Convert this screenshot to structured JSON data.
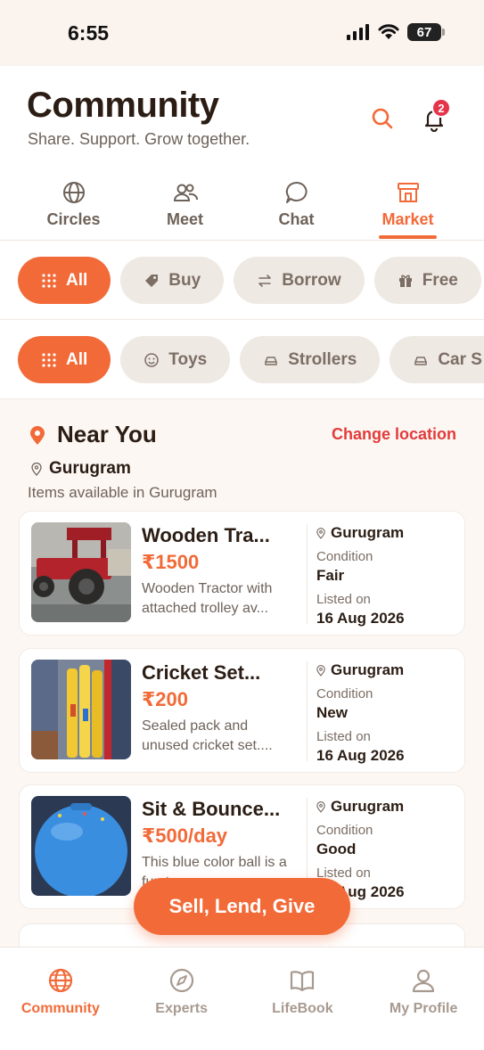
{
  "status_bar": {
    "time": "6:55",
    "battery": "67"
  },
  "header": {
    "title": "Community",
    "subtitle": "Share. Support. Grow together.",
    "notification_count": "2"
  },
  "tabs": [
    {
      "label": "Circles",
      "icon": "globe-icon",
      "active": false
    },
    {
      "label": "Meet",
      "icon": "people-icon",
      "active": false
    },
    {
      "label": "Chat",
      "icon": "chat-bubble-icon",
      "active": false
    },
    {
      "label": "Market",
      "icon": "store-icon",
      "active": true
    }
  ],
  "type_filters": [
    {
      "label": "All",
      "icon": "grid-icon",
      "active": true
    },
    {
      "label": "Buy",
      "icon": "tag-icon",
      "active": false
    },
    {
      "label": "Borrow",
      "icon": "swap-icon",
      "active": false
    },
    {
      "label": "Free",
      "icon": "gift-icon",
      "active": false
    }
  ],
  "category_filters": [
    {
      "label": "All",
      "icon": "grid-icon",
      "active": true
    },
    {
      "label": "Toys",
      "icon": "smiley-icon",
      "active": false
    },
    {
      "label": "Strollers",
      "icon": "car-icon",
      "active": false
    },
    {
      "label": "Car S",
      "icon": "car-icon",
      "active": false
    }
  ],
  "near_you": {
    "title": "Near You",
    "change_location": "Change location",
    "city": "Gurugram",
    "availability": "Items available in Gurugram"
  },
  "listings": [
    {
      "title": "Wooden Tra...",
      "price": "₹1500",
      "description": "Wooden Tractor with attached trolley av...",
      "city": "Gurugram",
      "condition_label": "Condition",
      "condition": "Fair",
      "listed_label": "Listed on",
      "listed_on": "16 Aug 2026"
    },
    {
      "title": "Cricket Set...",
      "price": "₹200",
      "description": "Sealed pack and unused cricket set....",
      "city": "Gurugram",
      "condition_label": "Condition",
      "condition": "New",
      "listed_label": "Listed on",
      "listed_on": "16 Aug 2026"
    },
    {
      "title": "Sit & Bounce...",
      "price": "₹500/day",
      "description": "This blue color ball is a fun toy...",
      "city": "Gurugram",
      "condition_label": "Condition",
      "condition": "Good",
      "listed_label": "Listed on",
      "listed_on": "16 Aug 2026"
    }
  ],
  "fab_label": "Sell, Lend, Give",
  "bottom_nav": [
    {
      "label": "Community",
      "icon": "globe-icon",
      "active": true
    },
    {
      "label": "Experts",
      "icon": "compass-icon",
      "active": false
    },
    {
      "label": "LifeBook",
      "icon": "book-icon",
      "active": false
    },
    {
      "label": "My Profile",
      "icon": "person-icon",
      "active": false
    }
  ],
  "colors": {
    "accent": "#f26a38",
    "alert": "#e23b3b",
    "chip_bg": "#efe9e4",
    "text": "#2b1d14"
  }
}
